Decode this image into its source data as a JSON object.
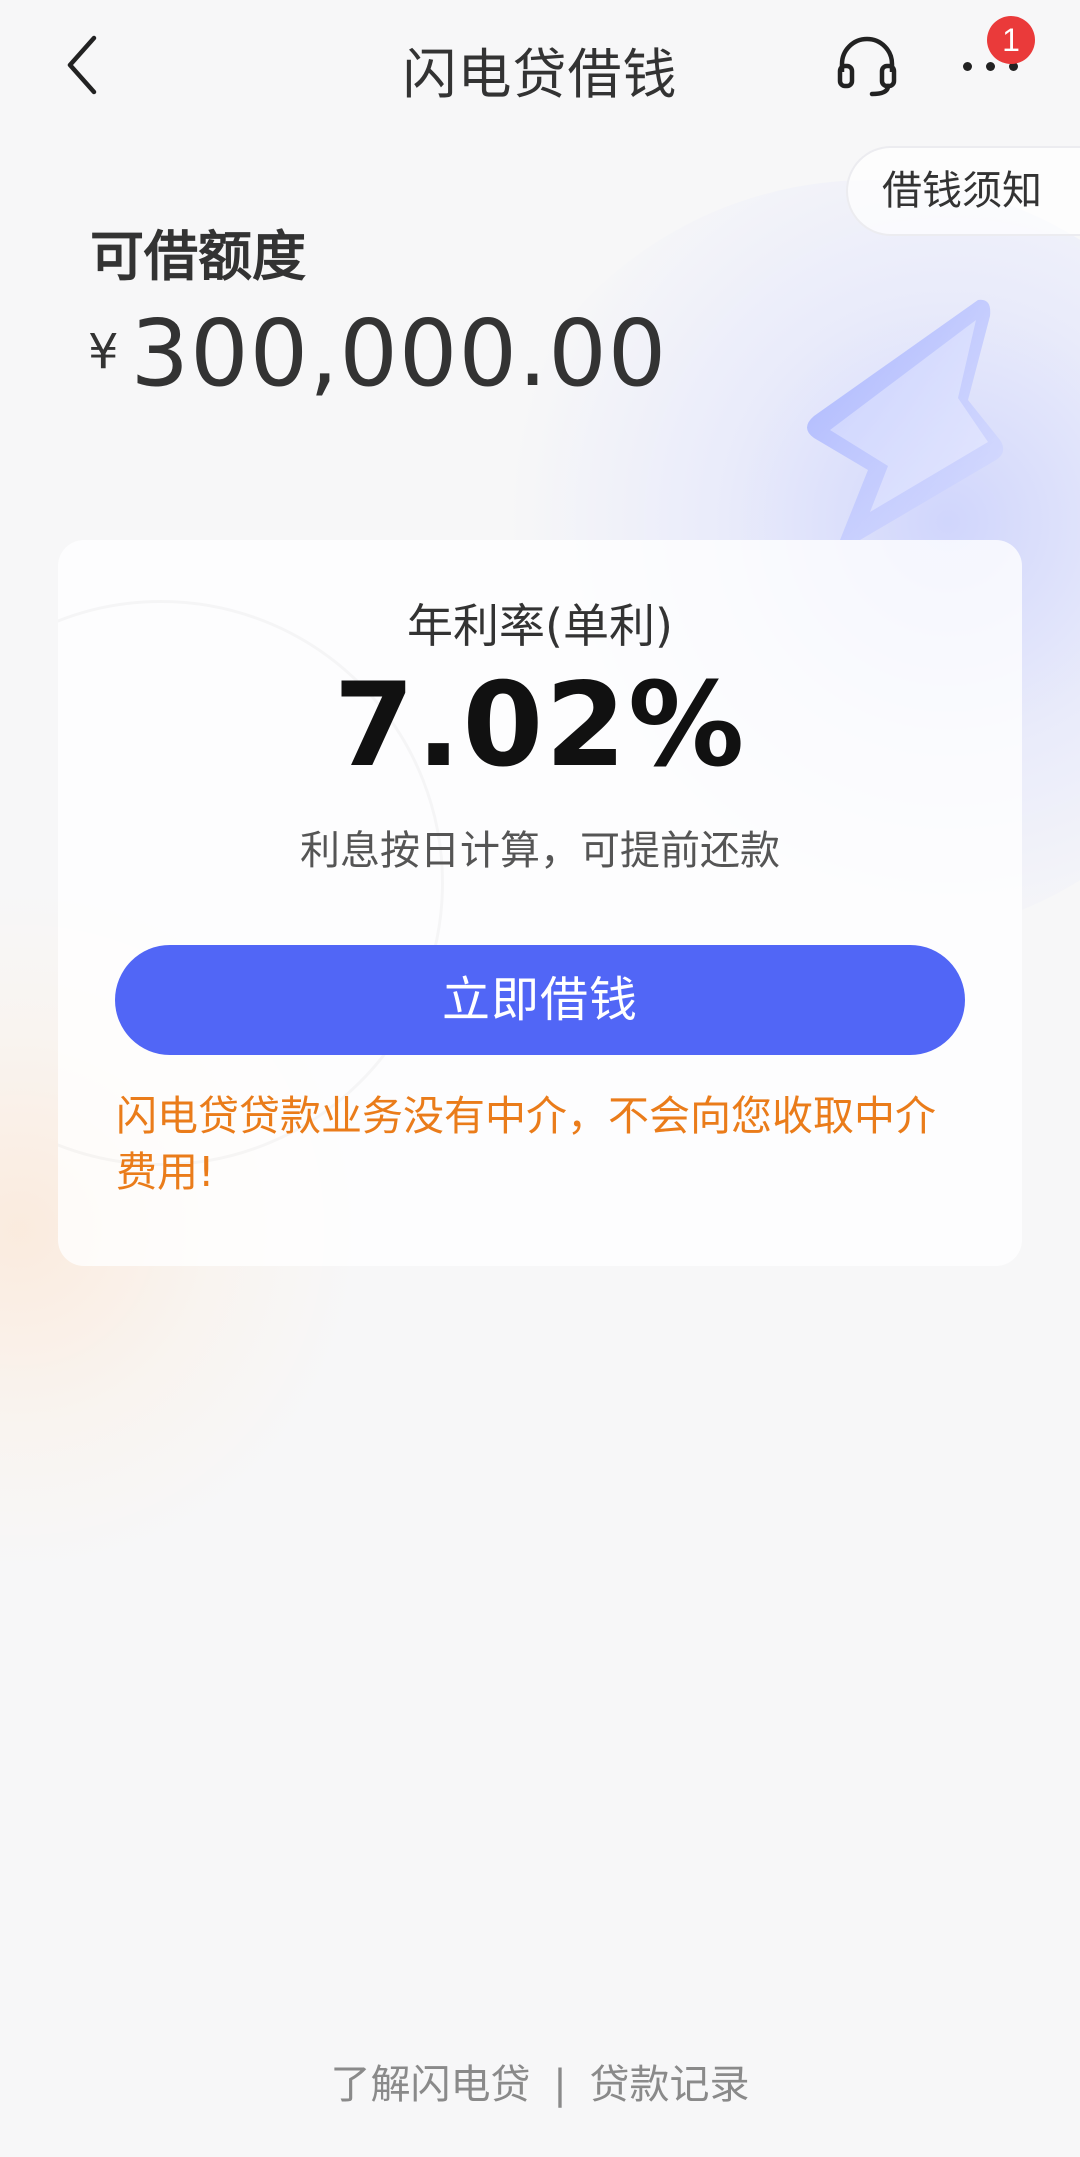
{
  "header": {
    "title": "闪电贷借钱",
    "more_badge": "1"
  },
  "notice_button": "借钱须知",
  "limit": {
    "label": "可借额度",
    "currency": "¥",
    "amount": "300,000.00"
  },
  "card": {
    "rate_label": "年利率(单利)",
    "rate_value": "7.02%",
    "rate_note": "利息按日计算，可提前还款",
    "borrow_button": "立即借钱",
    "warning": "闪电贷贷款业务没有中介，不会向您收取中介费用!"
  },
  "footer": {
    "learn_more": "了解闪电贷",
    "separator": "|",
    "loan_records": "贷款记录"
  },
  "colors": {
    "primary": "#5166f6",
    "warning": "#ea7c1a",
    "badge": "#ea3a3a",
    "background": "#f7f7f8"
  },
  "icons": [
    "back-arrow-icon",
    "headset-icon",
    "more-icon",
    "lightning-bolt-icon"
  ]
}
